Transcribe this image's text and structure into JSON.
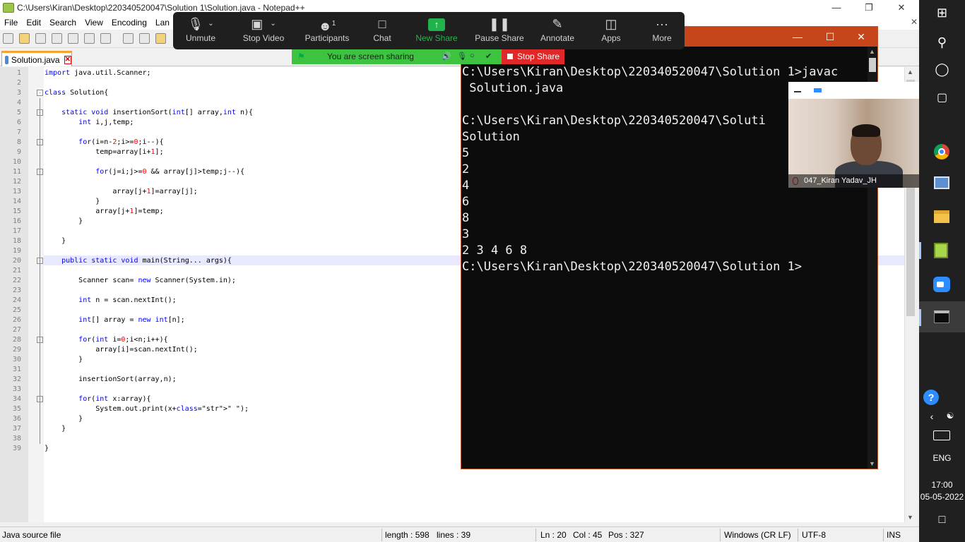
{
  "npp": {
    "title": "C:\\Users\\Kiran\\Desktop\\220340520047\\Solution 1\\Solution.java - Notepad++",
    "menu": [
      "File",
      "Edit",
      "Search",
      "View",
      "Encoding",
      "Lan"
    ],
    "tab_label": "Solution.java",
    "lines": [
      "import java.util.Scanner;",
      "",
      "class Solution{",
      "",
      "    static void insertionSort(int[] array,int n){",
      "        int i,j,temp;",
      "",
      "        for(i=n-2;i>=0;i--){",
      "            temp=array[i+1];",
      "",
      "            for(j=i;j>=0 && array[j]>temp;j--){",
      "",
      "                array[j+1]=array[j];",
      "            }",
      "            array[j+1]=temp;",
      "        }",
      "",
      "    }",
      "",
      "    public static void main(String... args){",
      "",
      "        Scanner scan= new Scanner(System.in);",
      "",
      "        int n = scan.nextInt();",
      "",
      "        int[] array = new int[n];",
      "",
      "        for(int i=0;i<n;i++){",
      "            array[i]=scan.nextInt();",
      "        }",
      "",
      "        insertionSort(array,n);",
      "",
      "        for(int x:array){",
      "            System.out.print(x+\" \");",
      "        }",
      "    }",
      "",
      "}"
    ],
    "status": {
      "type": "Java source file",
      "length": "length : 598",
      "lines": "lines : 39",
      "ln": "Ln : 20",
      "col": "Col : 45",
      "pos": "Pos : 327",
      "eol": "Windows (CR LF)",
      "enc": "UTF-8",
      "ins": "INS"
    }
  },
  "console": {
    "lines": [
      "C:\\Users\\Kiran\\Desktop\\220340520047\\Solution 1>javac",
      " Solution.java",
      "",
      "C:\\Users\\Kiran\\Desktop\\220340520047\\Soluti",
      "Solution",
      "5",
      "2",
      "4",
      "6",
      "8",
      "3",
      "2 3 4 6 8",
      "C:\\Users\\Kiran\\Desktop\\220340520047\\Solution 1>"
    ]
  },
  "zoom": {
    "buttons": [
      {
        "label": "Unmute",
        "icon": "mic-off-icon"
      },
      {
        "label": "Stop Video",
        "icon": "video-camera-icon"
      },
      {
        "label": "Participants",
        "icon": "participants-icon",
        "badge": "1"
      },
      {
        "label": "Chat",
        "icon": "chat-icon"
      },
      {
        "label": "New Share",
        "icon": "share-up-arrow-icon"
      },
      {
        "label": "Pause Share",
        "icon": "pause-icon"
      },
      {
        "label": "Annotate",
        "icon": "pencil-icon"
      },
      {
        "label": "Apps",
        "icon": "apps-icon"
      },
      {
        "label": "More",
        "icon": "more-dots-icon"
      }
    ],
    "sharing_text": "You are screen sharing",
    "stop_share": "Stop Share",
    "participant_name": "047_Kiran Yadav_JH",
    "accent_green": "#21b24b",
    "stop_red": "#e02828"
  },
  "taskbar": {
    "lang": "ENG",
    "time": "17:00",
    "date": "05-05-2022"
  }
}
